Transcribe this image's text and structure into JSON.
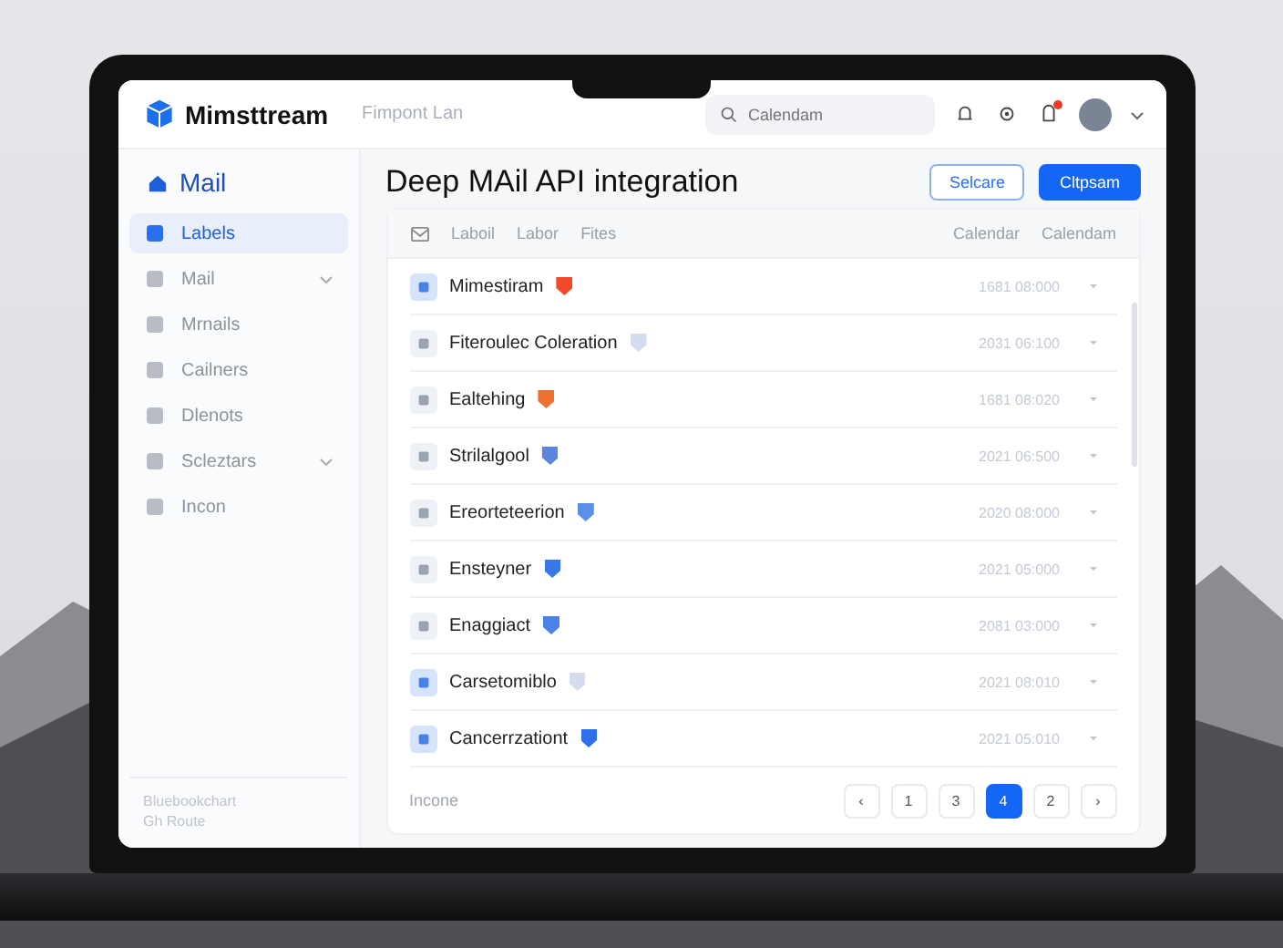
{
  "app": {
    "logo": "Mimsttream",
    "breadcrumb": "Fimpont Lan",
    "search": {
      "placeholder": "Calendam"
    },
    "notification_dot": true
  },
  "sidebar": {
    "heading": "Mail",
    "items": [
      {
        "label": "Labels",
        "selected": true,
        "expandable": false
      },
      {
        "label": "Mail",
        "selected": false,
        "expandable": true
      },
      {
        "label": "Mrnails",
        "selected": false,
        "expandable": false
      },
      {
        "label": "Cailners",
        "selected": false,
        "expandable": false
      },
      {
        "label": "Dlenots",
        "selected": false,
        "expandable": false
      },
      {
        "label": "Scleztars",
        "selected": false,
        "expandable": true
      },
      {
        "label": "Incon",
        "selected": false,
        "expandable": false
      }
    ],
    "footer": [
      "Bluebookchart",
      "Gh Route"
    ]
  },
  "page": {
    "title": "Deep MAil API integration",
    "buttons": [
      {
        "label": "Selcare",
        "kind": "outline"
      },
      {
        "label": "Cltpsam",
        "kind": "primary"
      }
    ]
  },
  "table": {
    "columns_left": [
      "Laboil",
      "Labor",
      "Fites"
    ],
    "columns_right": [
      "Calendar",
      "Calendam"
    ],
    "rows": [
      {
        "name": "Mimestiram",
        "color": "#f04a2a",
        "date": "1681 08:000",
        "highlight": true
      },
      {
        "name": "Fiteroulec Coleration",
        "color": "#d4dcee",
        "date": "2031 06:100",
        "highlight": false
      },
      {
        "name": "Ealtehing",
        "color": "#f07030",
        "date": "1681 08:020",
        "highlight": false
      },
      {
        "name": "Strilalgool",
        "color": "#5b86d9",
        "date": "2021 06:500",
        "highlight": false
      },
      {
        "name": "Ereorteteerion",
        "color": "#5b8fe8",
        "date": "2020 08:000",
        "highlight": false
      },
      {
        "name": "Ensteyner",
        "color": "#3a78e8",
        "date": "2021 05:000",
        "highlight": false
      },
      {
        "name": "Enaggiact",
        "color": "#4a82e8",
        "date": "2081 03:000",
        "highlight": false
      },
      {
        "name": "Carsetomiblo",
        "color": "#d4dcee",
        "date": "2021 08:010",
        "highlight": true
      },
      {
        "name": "Cancerrzationt",
        "color": "#2f6fe8",
        "date": "2021 05:010",
        "highlight": true
      }
    ],
    "footer": "Incone",
    "pages": [
      {
        "label": "‹",
        "selected": false
      },
      {
        "label": "1",
        "selected": false
      },
      {
        "label": "3",
        "selected": false
      },
      {
        "label": "4",
        "selected": true
      },
      {
        "label": "2",
        "selected": false
      },
      {
        "label": "›",
        "selected": false
      }
    ]
  }
}
